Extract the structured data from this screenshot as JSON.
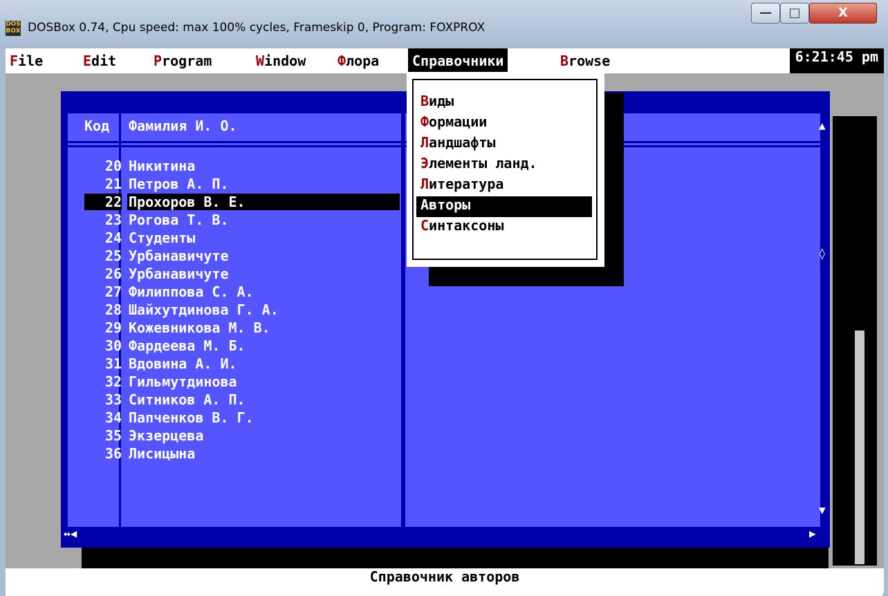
{
  "window": {
    "title": "DOSBox 0.74, Cpu speed: max 100% cycles, Frameskip  0, Program:  FOXPROX",
    "icon_text": "DOS BOX",
    "minimize_glyph": "—",
    "maximize_glyph": "□",
    "close_glyph": "X"
  },
  "menubar": {
    "items": [
      {
        "hotkey": "F",
        "rest": "ile"
      },
      {
        "hotkey": "E",
        "rest": "dit"
      },
      {
        "hotkey": "P",
        "rest": "rogram"
      },
      {
        "hotkey": "W",
        "rest": "indow"
      },
      {
        "hotkey": "Ф",
        "rest": "лора"
      },
      {
        "hotkey": "",
        "rest": "Справочники"
      },
      {
        "hotkey": "B",
        "rest": "rowse"
      }
    ],
    "active_index": 5,
    "clock": "6:21:45 pm"
  },
  "browse": {
    "col_code_header": "Код",
    "col_name_header": "Фамилия И. О.",
    "rows": [
      {
        "code": "20",
        "name": "Никитина"
      },
      {
        "code": "21",
        "name": "Петров А. П."
      },
      {
        "code": "22",
        "name": "Прохоров В. Е."
      },
      {
        "code": "23",
        "name": "Рогова Т. В."
      },
      {
        "code": "24",
        "name": "Студенты"
      },
      {
        "code": "25",
        "name": "Урбанавичуте"
      },
      {
        "code": "26",
        "name": "Урбанавичуте"
      },
      {
        "code": "27",
        "name": "Филиппова С. А."
      },
      {
        "code": "28",
        "name": "Шайхутдинова Г. А."
      },
      {
        "code": "29",
        "name": "Кожевникова М. В."
      },
      {
        "code": "30",
        "name": "Фардеева М. Б."
      },
      {
        "code": "31",
        "name": "Вдовина А. И."
      },
      {
        "code": "32",
        "name": "Гильмутдинова"
      },
      {
        "code": "33",
        "name": "Ситников А. П."
      },
      {
        "code": "34",
        "name": "Папченков В. Г."
      },
      {
        "code": "35",
        "name": "Экзерцева"
      },
      {
        "code": "36",
        "name": "Лисицына"
      }
    ],
    "selected_row": 2,
    "scroll_up": "▲",
    "scroll_thumb": "◊",
    "scroll_down": "▼",
    "hscroll_left": "↔◀",
    "hscroll_right": "▶"
  },
  "dropdown": {
    "items": [
      {
        "hotkey": "В",
        "rest": "иды"
      },
      {
        "hotkey": "Ф",
        "rest": "ормации"
      },
      {
        "hotkey": "Л",
        "rest": "андшафты"
      },
      {
        "hotkey": "Э",
        "rest": "лементы ланд."
      },
      {
        "hotkey": "Л",
        "rest": "итература"
      },
      {
        "hotkey": "А",
        "rest": "вторы"
      },
      {
        "hotkey": "С",
        "rest": "интаксоны"
      }
    ],
    "selected_index": 5
  },
  "statusbar": {
    "text": "Справочник авторов"
  }
}
